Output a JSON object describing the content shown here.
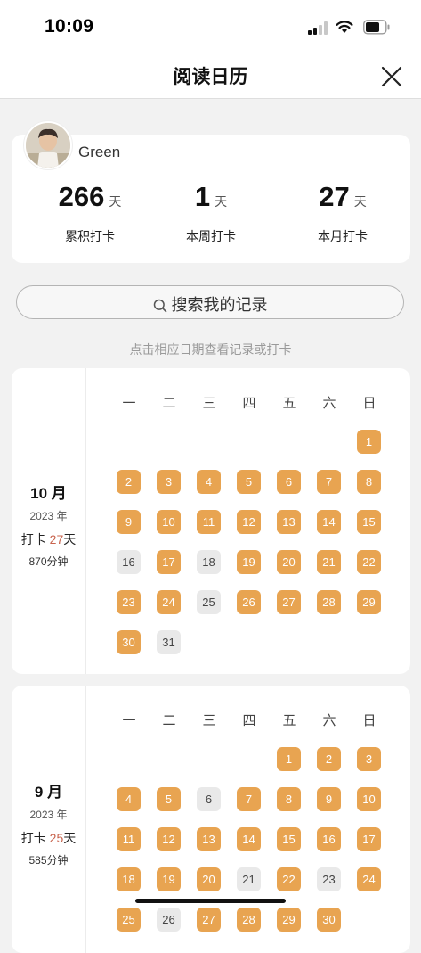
{
  "status_bar": {
    "time": "10:09"
  },
  "nav": {
    "title": "阅读日历"
  },
  "profile": {
    "username": "Green",
    "stats": [
      {
        "value": "266",
        "unit": "天",
        "label": "累积打卡"
      },
      {
        "value": "1",
        "unit": "天",
        "label": "本周打卡"
      },
      {
        "value": "27",
        "unit": "天",
        "label": "本月打卡"
      }
    ]
  },
  "search": {
    "placeholder": "搜索我的记录"
  },
  "hint": "点击相应日期查看记录或打卡",
  "weekdays": [
    "一",
    "二",
    "三",
    "四",
    "五",
    "六",
    "日"
  ],
  "months": [
    {
      "name": "10 月",
      "year": "2023 年",
      "checkin_prefix": "打卡 ",
      "checkin_days": "27",
      "checkin_suffix": "天",
      "minutes": "870分钟",
      "first_weekday": 7,
      "days_in_month": 31,
      "unchecked": [
        16,
        18,
        25,
        31
      ]
    },
    {
      "name": "9 月",
      "year": "2023 年",
      "checkin_prefix": "打卡 ",
      "checkin_days": "25",
      "checkin_suffix": "天",
      "minutes": "585分钟",
      "first_weekday": 5,
      "days_in_month": 30,
      "unchecked": [
        6,
        21,
        23,
        26
      ]
    }
  ],
  "colors": {
    "checked": "#e8a451",
    "unchecked": "#e9e9e9",
    "highlight": "#c8644e"
  }
}
